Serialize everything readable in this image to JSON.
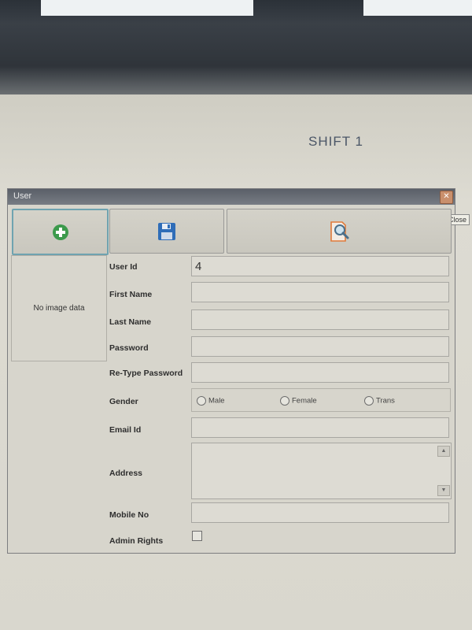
{
  "header": {
    "shift_label": "SHIFT   1"
  },
  "dialog": {
    "title": "User",
    "close_tooltip": "Close",
    "toolbar": {
      "add_icon": "plus-circle-icon",
      "save_icon": "floppy-disk-icon",
      "search_icon": "document-search-icon"
    },
    "image_panel": {
      "text": "No image data"
    },
    "form": {
      "user_id_label": "User Id",
      "user_id_value": "4",
      "first_name_label": "First Name",
      "last_name_label": "Last Name",
      "password_label": "Password",
      "retype_password_label": "Re-Type Password",
      "gender_label": "Gender",
      "gender_options": [
        "Male",
        "Female",
        "Trans"
      ],
      "email_label": "Email Id",
      "address_label": "Address",
      "mobile_label": "Mobile No",
      "admin_rights_label": "Admin Rights"
    },
    "colors": {
      "add_green": "#3c9a4c",
      "save_blue": "#2f6db8",
      "search_orange": "#e07a3a"
    }
  }
}
